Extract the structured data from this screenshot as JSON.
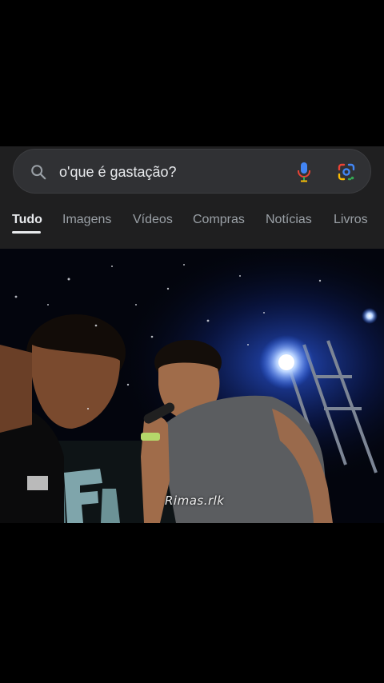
{
  "search": {
    "query": "o'que é gastação?",
    "search_icon": "search-icon",
    "voice_icon": "microphone-icon",
    "lens_icon": "google-lens-icon"
  },
  "tabs": [
    {
      "label": "Tudo",
      "active": true
    },
    {
      "label": "Imagens",
      "active": false
    },
    {
      "label": "Vídeos",
      "active": false
    },
    {
      "label": "Compras",
      "active": false
    },
    {
      "label": "Notícias",
      "active": false
    },
    {
      "label": "Livros",
      "active": false
    }
  ],
  "video": {
    "watermark": "Rimas.rlk",
    "description_colors": {
      "stage_light": "#bcd6ff",
      "background": "#03050d"
    }
  },
  "colors": {
    "panel": "#1f1f20",
    "search_bar": "#303134",
    "text_primary": "#e8eaed",
    "text_secondary": "#9aa0a6"
  }
}
